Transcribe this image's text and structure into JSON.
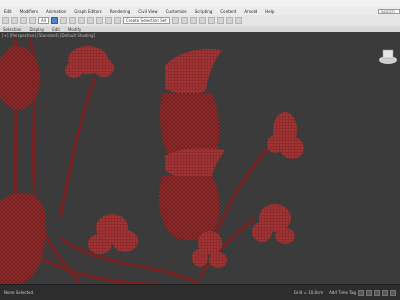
{
  "menu": {
    "items": [
      "Edit",
      "Modifiers",
      "Animation",
      "Graph Editors",
      "Rendering",
      "Civil View",
      "Customize",
      "Scripting",
      "Content",
      "Arnold",
      "Help"
    ],
    "search_placeholder": "Search"
  },
  "toolbar": {
    "selection_filter": "All",
    "named_set_placeholder": "Create Selection Set"
  },
  "toolbar2": {
    "items": [
      "Selection",
      "Display",
      "Edit",
      "Modify"
    ]
  },
  "viewport": {
    "label": "[+] [Perspective] [Standard] [Default Shading]"
  },
  "status": {
    "left": "None Selected",
    "grid": "Grid = 10,0cm",
    "right": "Add Time Tag"
  },
  "colors": {
    "model": "#8e2a2a",
    "model_highlight": "#b04040",
    "background": "#3b3b3b"
  }
}
